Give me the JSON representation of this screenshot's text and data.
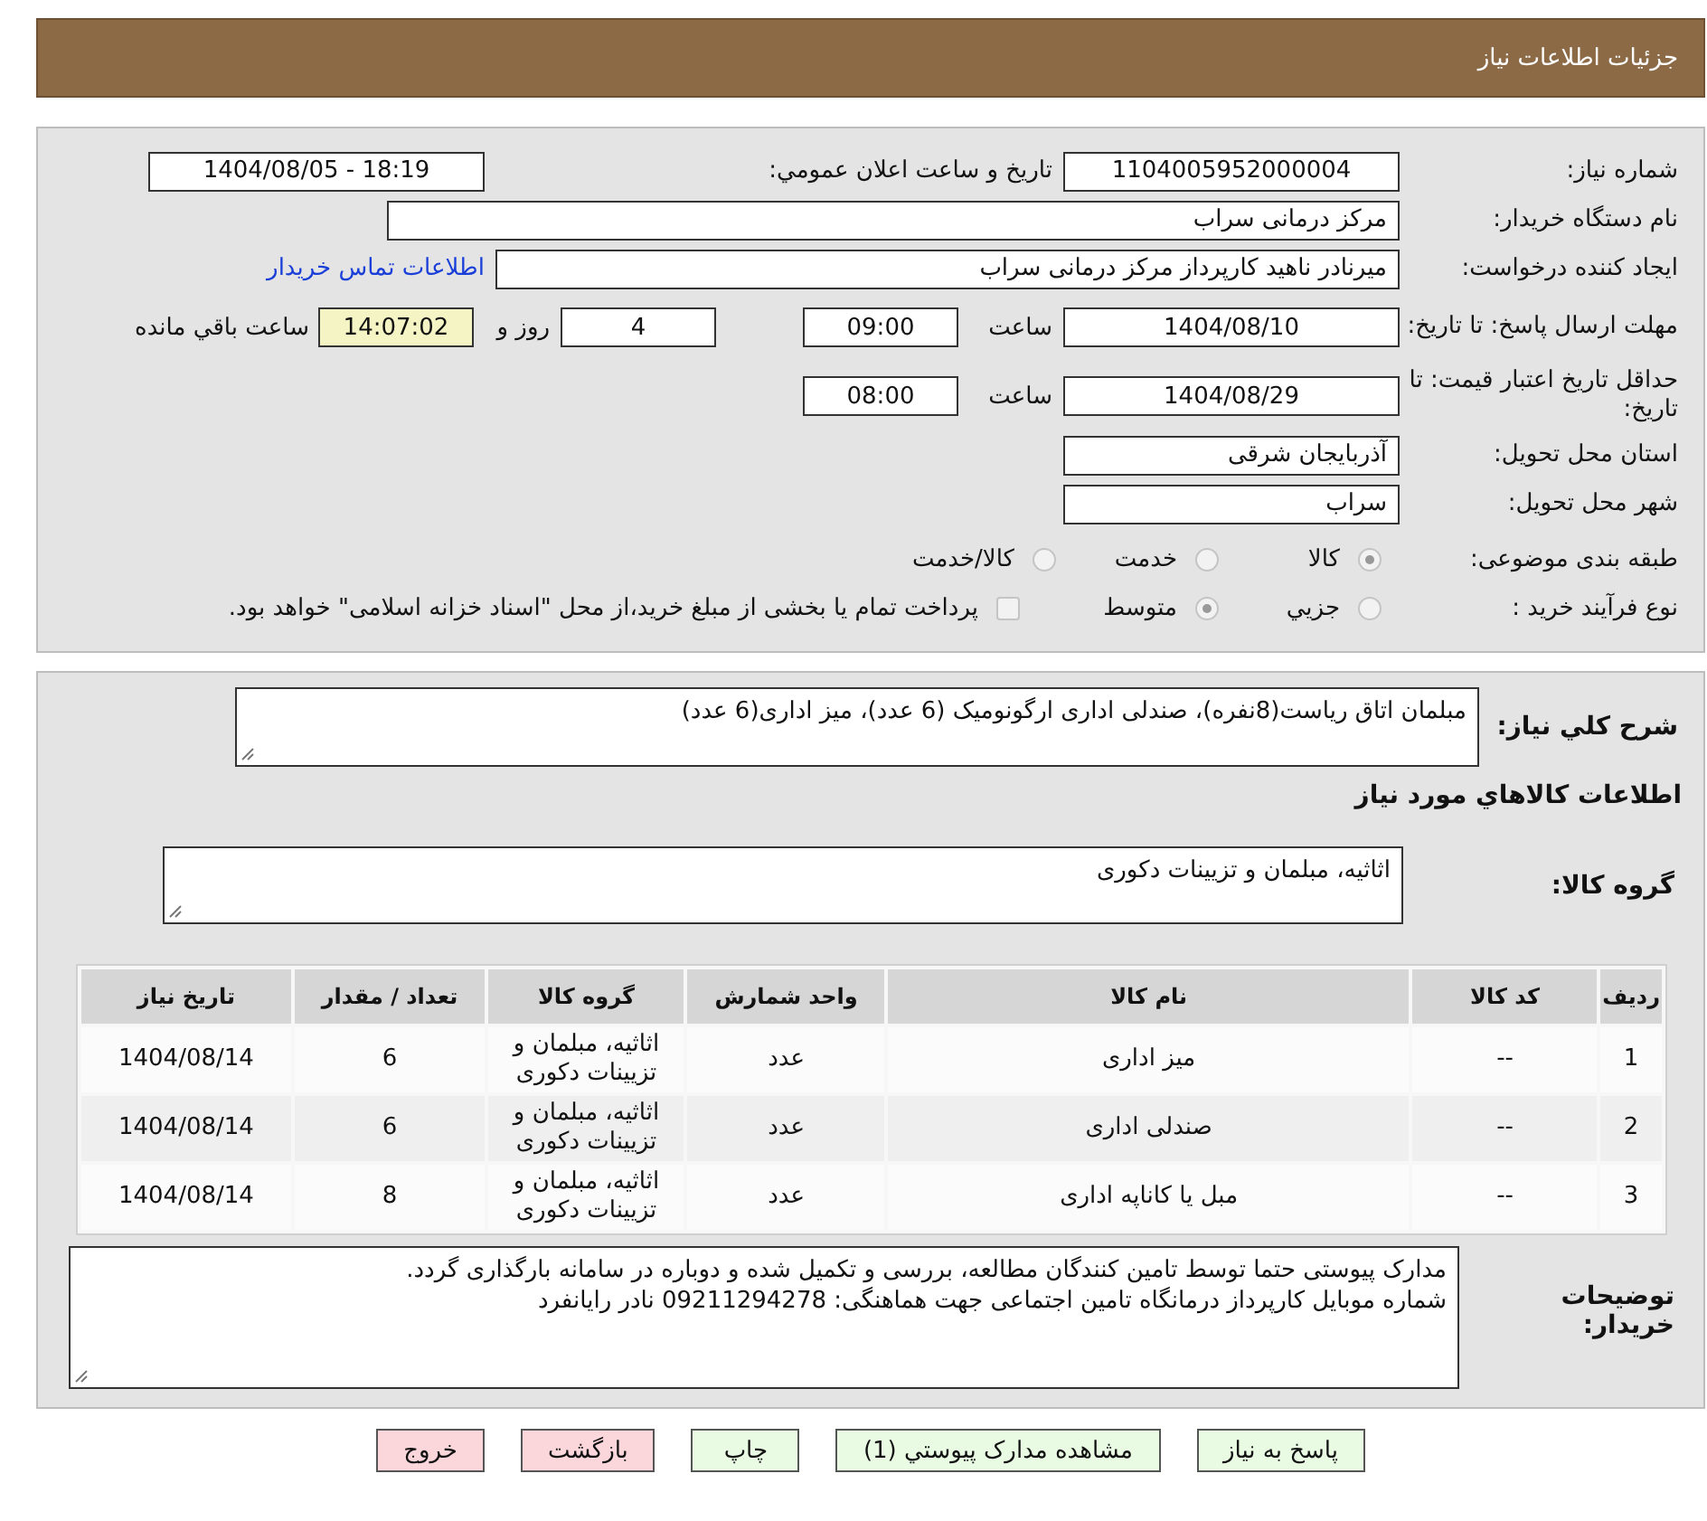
{
  "header": {
    "title": "جزئیات اطلاعات نیاز"
  },
  "need_number": {
    "label": "شماره نیاز:",
    "value": "1104005952000004"
  },
  "announce": {
    "label": "تاریخ و ساعت اعلان عمومي:",
    "value": "1404/08/05 - 18:19"
  },
  "buyer_org": {
    "label": "نام دستگاه خریدار:",
    "value": "مرکز درمانی سراب"
  },
  "requester": {
    "label": "ایجاد کننده درخواست:",
    "value": "میرنادر ناهید کارپرداز مرکز درمانی سراب",
    "link": "اطلاعات تماس خریدار"
  },
  "reply_deadline": {
    "label": "مهلت ارسال پاسخ: تا تاریخ:",
    "date": "1404/08/10",
    "time_label": "ساعت",
    "time": "09:00",
    "days": "4",
    "days_label": "روز و",
    "remaining": "14:07:02",
    "remaining_label": "ساعت باقي مانده"
  },
  "price_validity": {
    "label": "حداقل تاریخ اعتبار قیمت: تا تاریخ:",
    "date": "1404/08/29",
    "time_label": "ساعت",
    "time": "08:00"
  },
  "province": {
    "label": "استان محل تحویل:",
    "value": "آذربایجان شرقی"
  },
  "city": {
    "label": "شهر محل تحویل:",
    "value": "سراب"
  },
  "category": {
    "label": "طبقه بندی موضوعی:",
    "options": [
      {
        "label": "کالا",
        "selected": true
      },
      {
        "label": "خدمت",
        "selected": false
      },
      {
        "label": "کالا/خدمت",
        "selected": false
      }
    ]
  },
  "process": {
    "label": "نوع فرآیند خرید :",
    "options": [
      {
        "label": "جزيي",
        "selected": false
      },
      {
        "label": "متوسط",
        "selected": true
      }
    ],
    "payment": {
      "label": "پرداخت تمام یا بخشی از مبلغ خرید،از محل \"اسناد خزانه اسلامی\" خواهد بود.",
      "checked": false
    }
  },
  "summary": {
    "label": "شرح کلي نیاز:",
    "value": "مبلمان اتاق ریاست(8نفره)، صندلی اداری ارگونومیک (6 عدد)، میز اداری(6 عدد)"
  },
  "items_heading": "اطلاعات کالاهاي مورد نیاز",
  "goods_group": {
    "label": "گروه کالا:",
    "value": "اثاثیه، مبلمان و تزیینات دکوری"
  },
  "table": {
    "columns": [
      "ردیف",
      "کد کالا",
      "نام کالا",
      "واحد شمارش",
      "گروه کالا",
      "تعداد / مقدار",
      "تاریخ نیاز"
    ],
    "rows": [
      [
        "1",
        "--",
        "میز اداری",
        "عدد",
        "اثاثیه، مبلمان و تزیینات دکوری",
        "6",
        "1404/08/14"
      ],
      [
        "2",
        "--",
        "صندلی اداری",
        "عدد",
        "اثاثیه، مبلمان و تزیینات دکوری",
        "6",
        "1404/08/14"
      ],
      [
        "3",
        "--",
        "مبل یا کاناپه اداری",
        "عدد",
        "اثاثیه، مبلمان و تزیینات دکوری",
        "8",
        "1404/08/14"
      ]
    ]
  },
  "notes": {
    "label": "توضیحات خریدار:",
    "lines": [
      "مدارک پیوستی حتما توسط تامین کنندگان مطالعه، بررسی و تکمیل شده و دوباره در سامانه بارگذاری گردد.",
      "شماره موبایل کارپرداز درمانگاه تامین اجتماعی جهت هماهنگی: 09211294278 نادر رایانفرد"
    ]
  },
  "buttons": [
    {
      "label": "پاسخ به نیاز",
      "kind": "go"
    },
    {
      "label": "مشاهده مدارک پیوستي (1)",
      "kind": "go"
    },
    {
      "label": "چاپ",
      "kind": "go"
    },
    {
      "label": "بازگشت",
      "kind": "stop"
    },
    {
      "label": "خروج",
      "kind": "stop"
    }
  ]
}
